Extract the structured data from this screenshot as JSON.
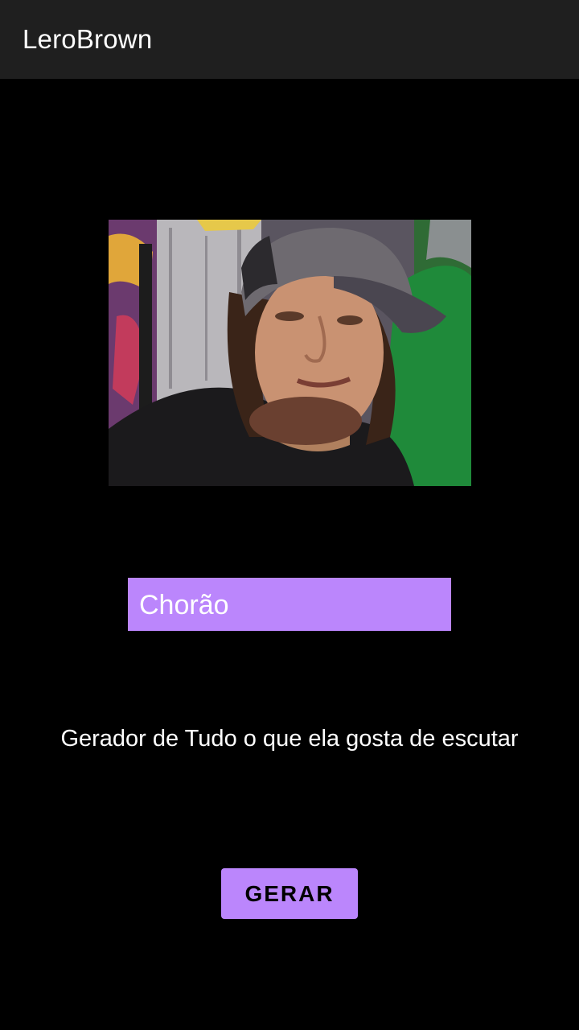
{
  "app_bar": {
    "title": "LeroBrown"
  },
  "main": {
    "photo": {
      "icon": "portrait-photo"
    },
    "name_display": "Chorão",
    "subtitle": "Gerador de Tudo o que ela gosta de escutar",
    "generate_button_label": "GERAR"
  },
  "colors": {
    "app_bar_bg": "#1f1f1f",
    "background": "#000000",
    "accent": "#bb86fc",
    "text_primary": "#ffffff",
    "button_text": "#000000"
  }
}
